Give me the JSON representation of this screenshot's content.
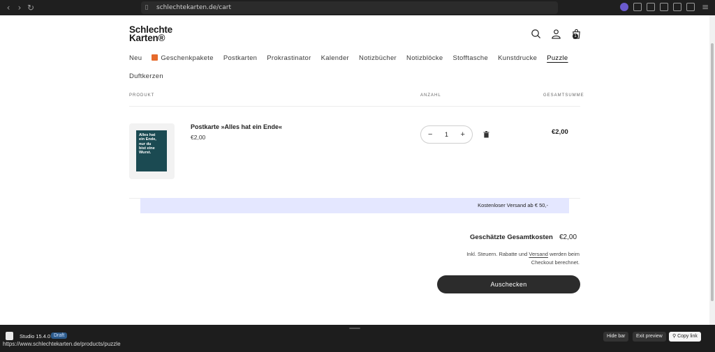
{
  "browser": {
    "url": "schlechtekarten.de/cart"
  },
  "header": {
    "logo_line1": "Schlechte",
    "logo_line2": "Karten®",
    "cart_count": "1"
  },
  "menu": {
    "items": [
      "Neu",
      "Geschenkpakete",
      "Postkarten",
      "Prokrastinator",
      "Kalender",
      "Notizbücher",
      "Notizblöcke",
      "Stofftasche",
      "Kunstdrucke",
      "Puzzle",
      "Duftkerzen"
    ],
    "active": "Puzzle"
  },
  "cart_table": {
    "col_product": "PRODUKT",
    "col_qty": "ANZAHL",
    "col_total": "GESAMTSUMME"
  },
  "item": {
    "card_lines": [
      "Alles hat",
      "ein Ende,",
      "nur du",
      "bist eine",
      "Wurst."
    ],
    "name": "Postkarte »Alles hat ein Ende«",
    "price": "€2,00",
    "quantity": "1",
    "line_total": "€2,00"
  },
  "shipping_banner": "Kostenloser Versand ab € 50,-",
  "summary": {
    "label": "Geschätzte Gesamtkosten",
    "value": "€2,00",
    "note_pre": "Inkl. Steuern. Rabatte und",
    "note_link": "Versand",
    "note_post": "werden beim Checkout berechnet.",
    "checkout_label": "Auschecken"
  },
  "shopify_bar": {
    "studio": "Studio 15.4.0",
    "draft": "Draft",
    "hide_bar": "Hide bar",
    "exit_preview": "Exit preview",
    "copy_link": "Copy link"
  },
  "status_url": "https://www.schlechtekarten.de/products/puzzle"
}
